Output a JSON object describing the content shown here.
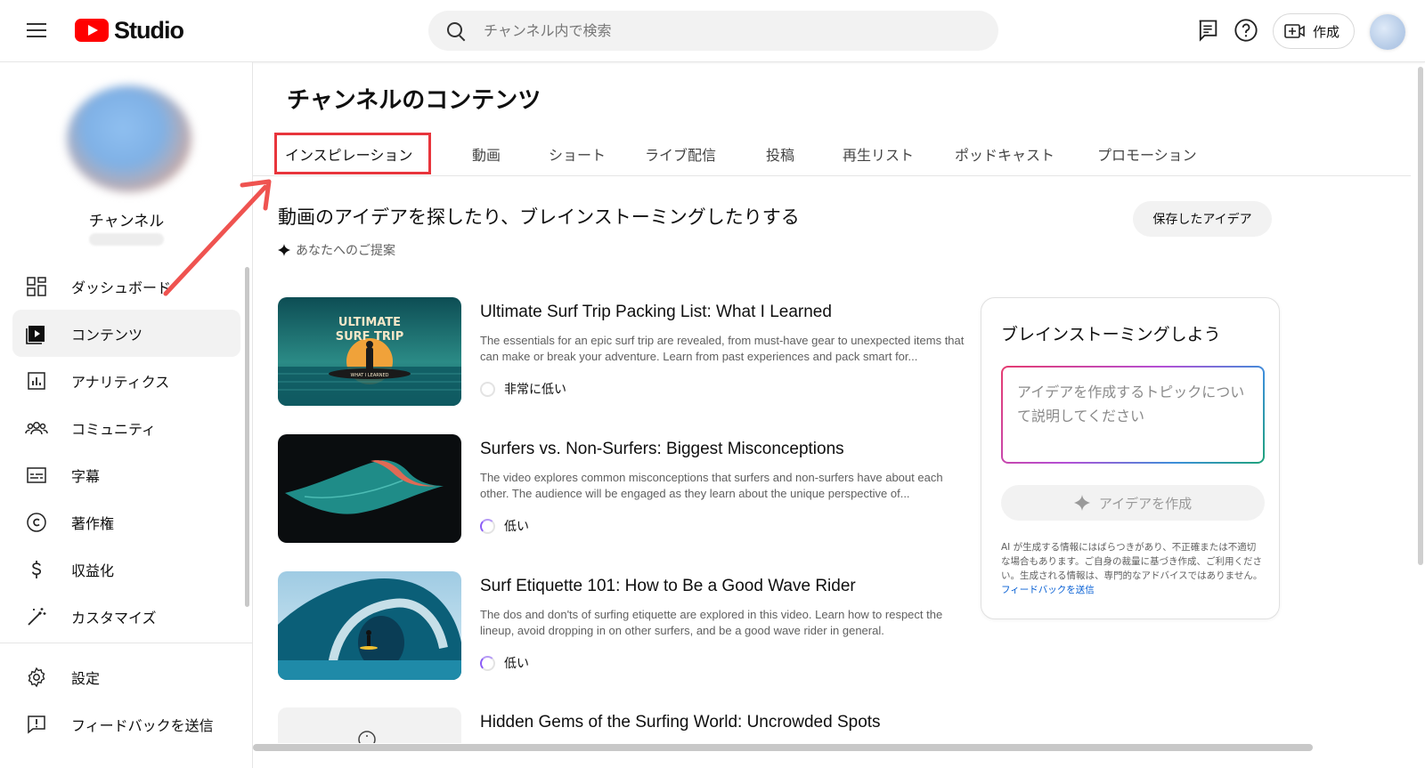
{
  "app": {
    "logo_text": "Studio"
  },
  "search": {
    "placeholder": "チャンネル内で検索"
  },
  "topbar": {
    "create_label": "作成"
  },
  "channel": {
    "name": "チャンネル"
  },
  "sidebar": {
    "items": [
      {
        "label": "ダッシュボード",
        "icon": "dashboard-icon"
      },
      {
        "label": "コンテンツ",
        "icon": "content-icon",
        "active": true
      },
      {
        "label": "アナリティクス",
        "icon": "analytics-icon"
      },
      {
        "label": "コミュニティ",
        "icon": "community-icon"
      },
      {
        "label": "字幕",
        "icon": "subtitles-icon"
      },
      {
        "label": "著作権",
        "icon": "copyright-icon"
      },
      {
        "label": "収益化",
        "icon": "monetization-icon"
      },
      {
        "label": "カスタマイズ",
        "icon": "customize-icon"
      }
    ],
    "bottom": [
      {
        "label": "設定",
        "icon": "settings-icon"
      },
      {
        "label": "フィードバックを送信",
        "icon": "feedback-icon"
      }
    ]
  },
  "main": {
    "title": "チャンネルのコンテンツ",
    "tabs": [
      "インスピレーション",
      "動画",
      "ショート",
      "ライブ配信",
      "投稿",
      "再生リスト",
      "ポッドキャスト",
      "プロモーション"
    ],
    "active_tab": "インスピレーション",
    "headline": "動画のアイデアを探したり、ブレインストーミングしたりする",
    "suggestions_label": "あなたへのご提案",
    "saved_ideas_label": "保存したアイデア"
  },
  "ideas": [
    {
      "title": "Ultimate Surf Trip Packing List: What I Learned",
      "description": "The essentials for an epic surf trip are revealed, from must-have gear to unexpected items that can make or break your adventure. Learn from past experiences and pack smart for...",
      "level": "非常に低い",
      "thumb_text_top": "ULTIMATE",
      "thumb_text_mid": "SURF TRIP",
      "thumb_text_board": "WHAT I LEARNED"
    },
    {
      "title": "Surfers vs. Non-Surfers: Biggest Misconceptions",
      "description": "The video explores common misconceptions that surfers and non-surfers have about each other. The audience will be engaged as they learn about the unique perspective of...",
      "level": "低い"
    },
    {
      "title": "Surf Etiquette 101: How to Be a Good Wave Rider",
      "description": "The dos and don'ts of surfing etiquette are explored in this video. Learn how to respect the lineup, avoid dropping in on other surfers, and be a good wave rider in general.",
      "level": "低い"
    },
    {
      "title": "Hidden Gems of the Surfing World: Uncrowded Spots"
    }
  ],
  "brainstorm": {
    "title": "ブレインストーミングしよう",
    "placeholder": "アイデアを作成するトピックについて説明してください",
    "button_label": "アイデアを作成",
    "disclaimer": "AI が生成する情報にはばらつきがあり、不正確または不適切な場合もあります。ご自身の裁量に基づき作成、ご利用ください。生成される情報は、専門的なアドバイスではありません。",
    "feedback_link": "フィードバックを送信"
  },
  "colors": {
    "brand_red": "#ff0000",
    "highlight_red": "#e8353c",
    "link_blue": "#065fd4"
  }
}
